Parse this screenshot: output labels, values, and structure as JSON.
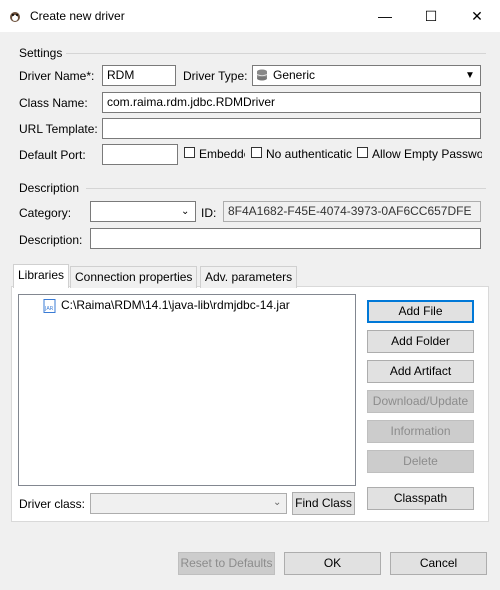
{
  "window": {
    "title": "Create new driver",
    "minimize_glyph": "—",
    "maximize_glyph": "☐",
    "close_glyph": "✕"
  },
  "settings": {
    "group_label": "Settings",
    "driver_name_label": "Driver Name*:",
    "driver_name_value": "RDM",
    "driver_type_label": "Driver Type:",
    "driver_type_value": "Generic",
    "class_name_label": "Class Name:",
    "class_name_value": "com.raima.rdm.jdbc.RDMDriver",
    "url_template_label": "URL Template:",
    "url_template_value": "",
    "default_port_label": "Default Port:",
    "default_port_value": "",
    "embedded_label": "Embedde",
    "no_auth_label": "No authenticatic",
    "allow_empty_label": "Allow Empty Passwo"
  },
  "description": {
    "group_label": "Description",
    "category_label": "Category:",
    "category_value": "",
    "id_label": "ID:",
    "id_value": "8F4A1682-F45E-4074-3973-0AF6CC657DFE",
    "description_label": "Description:",
    "description_value": ""
  },
  "tabs": [
    {
      "label": "Libraries"
    },
    {
      "label": "Connection properties"
    },
    {
      "label": "Adv. parameters"
    }
  ],
  "libraries": {
    "items": [
      "C:\\Raima\\RDM\\14.1\\java-lib\\rdmjdbc-14.jar"
    ],
    "buttons": {
      "add_file": "Add File",
      "add_folder": "Add Folder",
      "add_artifact": "Add Artifact",
      "download_update": "Download/Update",
      "information": "Information",
      "delete": "Delete",
      "classpath": "Classpath"
    },
    "driver_class_label": "Driver class:",
    "driver_class_value": "",
    "find_class": "Find Class"
  },
  "footer": {
    "reset": "Reset to Defaults",
    "ok": "OK",
    "cancel": "Cancel"
  },
  "colors": {
    "accent": "#0078d7",
    "jar_icon": "#3a7bd5"
  }
}
